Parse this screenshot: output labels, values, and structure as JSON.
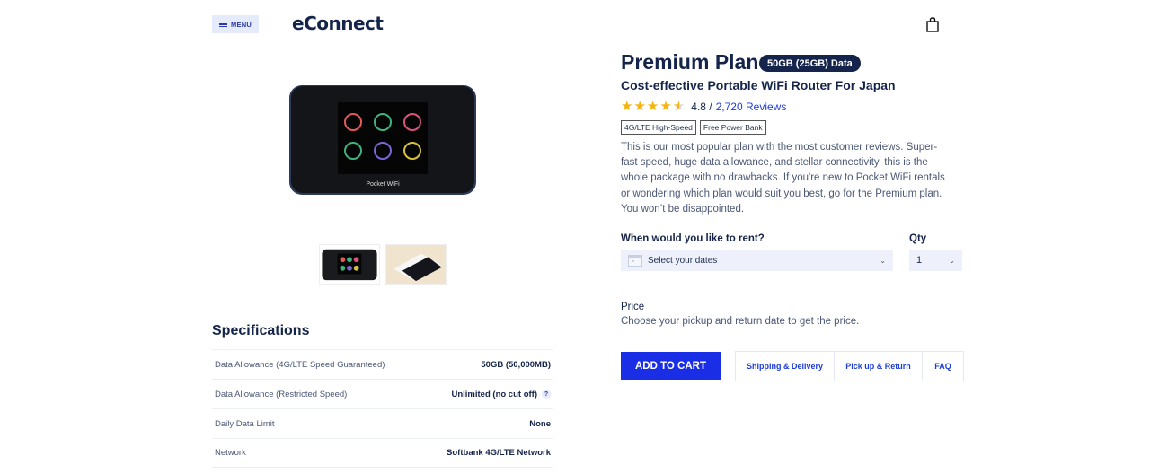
{
  "header": {
    "menu_label": "MENU",
    "logo_text": "eConnect",
    "cart_icon": "shopping-bag-icon"
  },
  "gallery": {
    "main_image": "pocket-wifi-router-front",
    "thumbnails": [
      "pocket-wifi-router-front",
      "pocket-wifi-router-with-phone"
    ],
    "device_brand_text": "Pocket WiFi"
  },
  "product": {
    "title": "Premium Plan",
    "data_badge": "50GB (25GB) Data",
    "subtitle": "Cost-effective Portable WiFi Router For Japan",
    "rating": {
      "stars": 4.5,
      "value_text": "4.8 /",
      "reviews_text": "2,720 Reviews"
    },
    "tags": [
      "4G/LTE High-Speed",
      "Free Power Bank"
    ],
    "description": "This is our most popular plan with the most customer reviews. Super-fast speed, huge data allowance, and stellar connectivity, this is the whole package with no drawbacks. If you're new to Pocket WiFi rentals or wondering which plan would suit you best, go for the Premium plan. You won’t be disappointed."
  },
  "booking": {
    "rent_label": "When would you like to rent?",
    "date_placeholder": "Select your dates",
    "qty_label": "Qty",
    "qty_value": "1",
    "price_label": "Price",
    "price_note": "Choose your pickup and return date to get the price.",
    "add_to_cart_label": "ADD TO CART",
    "info_tabs": [
      "Shipping & Delivery",
      "Pick up & Return",
      "FAQ"
    ]
  },
  "specifications": {
    "title": "Specifications",
    "rows": [
      {
        "label": "Data Allowance (4G/LTE Speed Guaranteed)",
        "value": "50GB (50,000MB)",
        "help": false
      },
      {
        "label": "Data Allowance (Restricted Speed)",
        "value": "Unlimited (no cut off)",
        "help": true
      },
      {
        "label": "Daily Data Limit",
        "value": "None",
        "help": false
      },
      {
        "label": "Network",
        "value": "Softbank 4G/LTE Network",
        "help": false
      }
    ],
    "help_glyph": "?"
  },
  "colors": {
    "primary_navy": "#14244a",
    "accent_blue": "#1a2ee6",
    "link_blue": "#1e3ed6",
    "star_gold": "#f5b50c"
  }
}
